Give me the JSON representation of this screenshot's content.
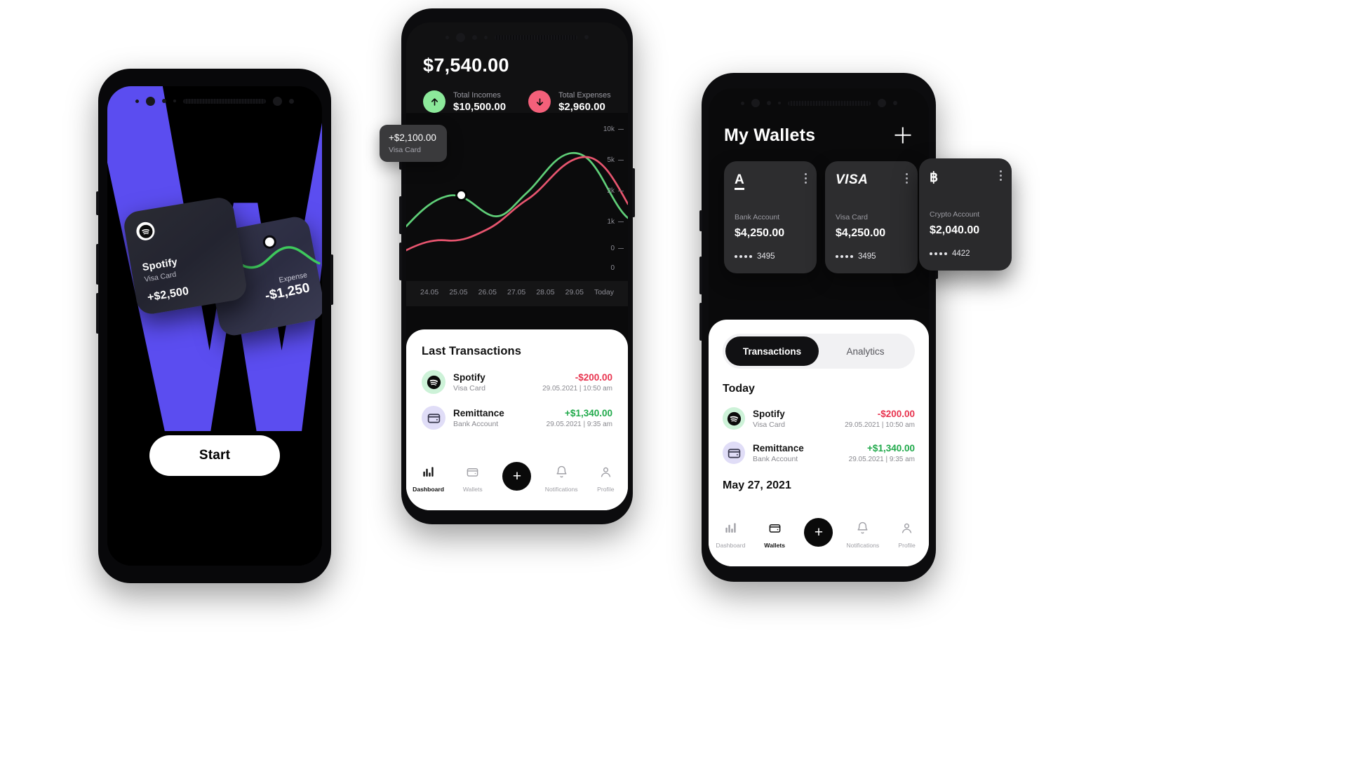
{
  "phone1": {
    "cards": [
      {
        "brand": "Spotify",
        "sub": "Visa Card",
        "amount": "+$2,500",
        "icon": "spotify-icon"
      },
      {
        "label": "Expense",
        "amount": "-$1,250"
      }
    ],
    "start_button": "Start",
    "watermark_letter": "W"
  },
  "phone2": {
    "balance": "$7,540.00",
    "kpis": [
      {
        "label": "Total Incomes",
        "value": "$10,500.00",
        "icon": "arrow-up-icon",
        "color": "#8ce99a"
      },
      {
        "label": "Total Expenses",
        "value": "$2,960.00",
        "icon": "arrow-down-icon",
        "color": "#f4607a"
      }
    ],
    "tooltip": {
      "amount": "+$2,100.00",
      "sub": "Visa Card"
    },
    "transactions_title": "Last Transactions",
    "transactions": [
      {
        "name": "Spotify",
        "sub": "Visa Card",
        "amount": "-$200.00",
        "date": "29.05.2021 | 10:50 am",
        "positive": false,
        "icon": "spotify-icon",
        "avatar_color": "#cdf2d8"
      },
      {
        "name": "Remittance",
        "sub": "Bank Account",
        "amount": "+$1,340.00",
        "date": "29.05.2021 | 9:35 am",
        "positive": true,
        "icon": "wallet-icon",
        "avatar_color": "#e0ddf7"
      }
    ],
    "nav": [
      {
        "label": "Dashboard",
        "icon": "bar-chart-icon",
        "active": true
      },
      {
        "label": "Wallets",
        "icon": "wallet-icon",
        "active": false
      },
      {
        "label": "",
        "icon": "plus-fab-icon",
        "active": false
      },
      {
        "label": "Notifications",
        "icon": "bell-icon",
        "active": false
      },
      {
        "label": "Profile",
        "icon": "person-icon",
        "active": false
      }
    ],
    "chart_data": {
      "type": "line",
      "title": "",
      "xlabel": "",
      "ylabel": "",
      "x": [
        "24.05",
        "25.05",
        "26.05",
        "27.05",
        "28.05",
        "29.05",
        "Today"
      ],
      "ytick_labels": [
        "10k",
        "5k",
        "2k",
        "1k",
        "0",
        "0"
      ],
      "ylim": [
        0,
        10000
      ],
      "grid": false,
      "legend": "none",
      "series": [
        {
          "name": "Income",
          "color": "#5fcf78",
          "values": [
            2600,
            4100,
            4900,
            3400,
            3900,
            7900,
            9300,
            5200,
            2700
          ]
        },
        {
          "name": "Expense",
          "color": "#e8556f",
          "values": [
            1900,
            1500,
            1600,
            2300,
            3000,
            3900,
            6200,
            9200,
            6400
          ]
        }
      ],
      "marker": {
        "series": "Income",
        "index": 2,
        "label": "+$2,100.00",
        "sub": "Visa Card"
      }
    }
  },
  "phone3": {
    "title": "My Wallets",
    "add_button": "+",
    "wallets": [
      {
        "logo": "A",
        "logo_style": "underline",
        "type": "Bank Account",
        "balance": "$4,250.00",
        "number": "3495"
      },
      {
        "logo": "VISA",
        "logo_style": "italic",
        "type": "Visa Card",
        "balance": "$4,250.00",
        "number": "3495"
      },
      {
        "logo": "฿",
        "logo_style": "plain",
        "type": "Crypto Account",
        "balance": "$2,040.00",
        "number": "4422"
      }
    ],
    "tabs": [
      {
        "label": "Transactions",
        "active": true
      },
      {
        "label": "Analytics",
        "active": false
      }
    ],
    "today_label": "Today",
    "transactions": [
      {
        "name": "Spotify",
        "sub": "Visa Card",
        "amount": "-$200.00",
        "date": "29.05.2021 | 10:50 am",
        "positive": false,
        "icon": "spotify-icon",
        "avatar_color": "#cdf2d8"
      },
      {
        "name": "Remittance",
        "sub": "Bank Account",
        "amount": "+$1,340.00",
        "date": "29.05.2021 | 9:35 am",
        "positive": true,
        "icon": "wallet-icon",
        "avatar_color": "#e0ddf7"
      }
    ],
    "date_header": "May 27, 2021",
    "nav": [
      {
        "label": "Dashboard",
        "icon": "bar-chart-icon",
        "active": false
      },
      {
        "label": "Wallets",
        "icon": "wallet-icon",
        "active": true
      },
      {
        "label": "",
        "icon": "plus-fab-icon",
        "active": false
      },
      {
        "label": "Notifications",
        "icon": "bell-icon",
        "active": false
      },
      {
        "label": "Profile",
        "icon": "person-icon",
        "active": false
      }
    ]
  },
  "colors": {
    "accent_purple": "#5b4df0",
    "income_green": "#5fcf78",
    "expense_red": "#e8556f",
    "amount_negative": "#e8334e",
    "amount_positive": "#1fa94a"
  }
}
